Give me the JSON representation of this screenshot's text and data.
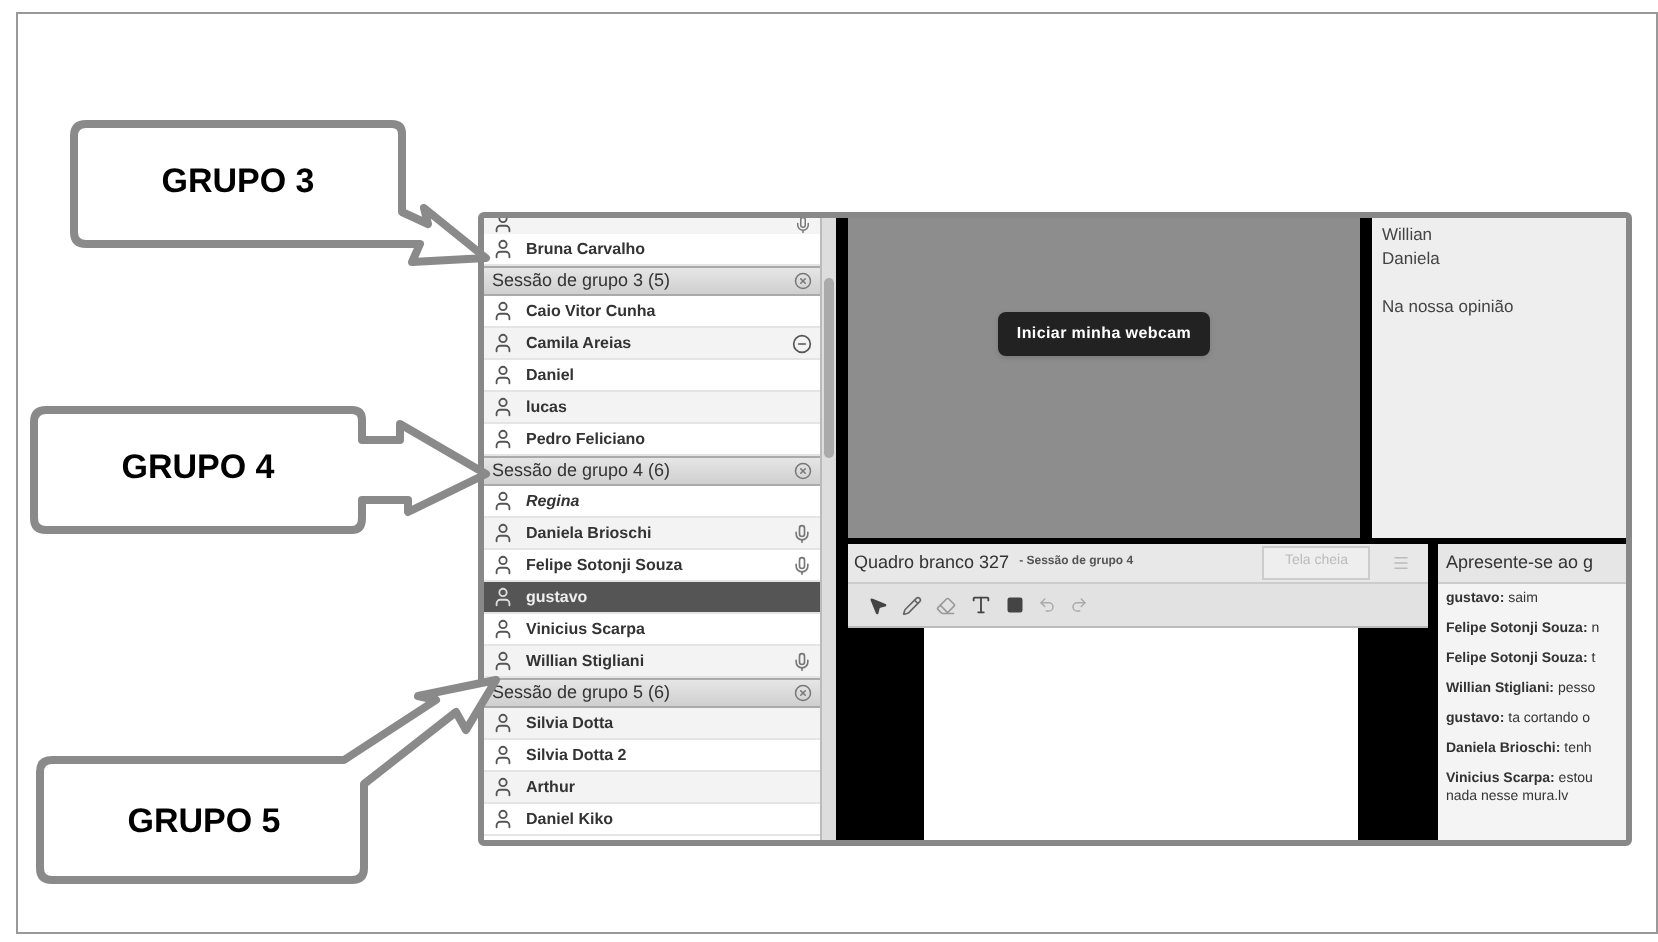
{
  "callouts": [
    {
      "label": "GRUPO 3"
    },
    {
      "label": "GRUPO 4"
    },
    {
      "label": "GRUPO 5"
    }
  ],
  "attendees": [
    {
      "kind": "cut",
      "mic": true
    },
    {
      "kind": "person",
      "name": "Bruna Carvalho",
      "selected": false,
      "mic": false
    },
    {
      "kind": "header",
      "name": "Sessão de grupo 3 (5)"
    },
    {
      "kind": "person",
      "name": "Caio Vitor Cunha",
      "selected": false,
      "mic": false
    },
    {
      "kind": "person",
      "name": "Camila Areias",
      "selected": false,
      "mic": false,
      "busy": true
    },
    {
      "kind": "person",
      "name": "Daniel",
      "selected": false,
      "mic": false
    },
    {
      "kind": "person",
      "name": "lucas",
      "selected": false,
      "mic": false
    },
    {
      "kind": "person",
      "name": "Pedro Feliciano",
      "selected": false,
      "mic": false
    },
    {
      "kind": "header",
      "name": "Sessão de grupo 4 (6)"
    },
    {
      "kind": "host",
      "name": "Regina",
      "selected": false,
      "mic": false
    },
    {
      "kind": "person",
      "name": "Daniela Brioschi",
      "selected": false,
      "mic": true
    },
    {
      "kind": "person",
      "name": "Felipe Sotonji Souza",
      "selected": false,
      "mic": true
    },
    {
      "kind": "person",
      "name": "gustavo",
      "selected": true,
      "mic": false
    },
    {
      "kind": "person",
      "name": "Vinicius Scarpa",
      "selected": false,
      "mic": false
    },
    {
      "kind": "person",
      "name": "Willian Stigliani",
      "selected": false,
      "mic": true
    },
    {
      "kind": "header",
      "name": "Sessão de grupo 5 (6)"
    },
    {
      "kind": "person",
      "name": "Silvia Dotta",
      "selected": false,
      "mic": false
    },
    {
      "kind": "person",
      "name": "Silvia Dotta 2",
      "selected": false,
      "mic": false
    },
    {
      "kind": "person",
      "name": "Arthur",
      "selected": false,
      "mic": false
    },
    {
      "kind": "person",
      "name": "Daniel Kiko",
      "selected": false,
      "mic": false
    }
  ],
  "webcam": {
    "button": "Iniciar minha webcam"
  },
  "notes": {
    "paragraphs": [
      [
        "Willian",
        "Daniela"
      ],
      [
        "Na nossa opinião"
      ]
    ]
  },
  "whiteboard": {
    "title": "Quadro branco 327",
    "session": "- Sessão de grupo 4",
    "fullscreen_button": "Tela cheia"
  },
  "chat": {
    "title": "Apresente-se ao g",
    "messages": [
      {
        "author": "gustavo:",
        "text": "saim"
      },
      {
        "author": "Felipe Sotonji Souza:",
        "text": "n"
      },
      {
        "author": "Felipe Sotonji Souza:",
        "text": "t"
      },
      {
        "author": "Willian Stigliani:",
        "text": "pesso"
      },
      {
        "author": "gustavo:",
        "text": "ta cortando o"
      },
      {
        "author": "Daniela Brioschi:",
        "text": "tenh"
      },
      {
        "author": "Vinicius Scarpa:",
        "text": "estou\nnada nesse mura.lv"
      }
    ]
  }
}
